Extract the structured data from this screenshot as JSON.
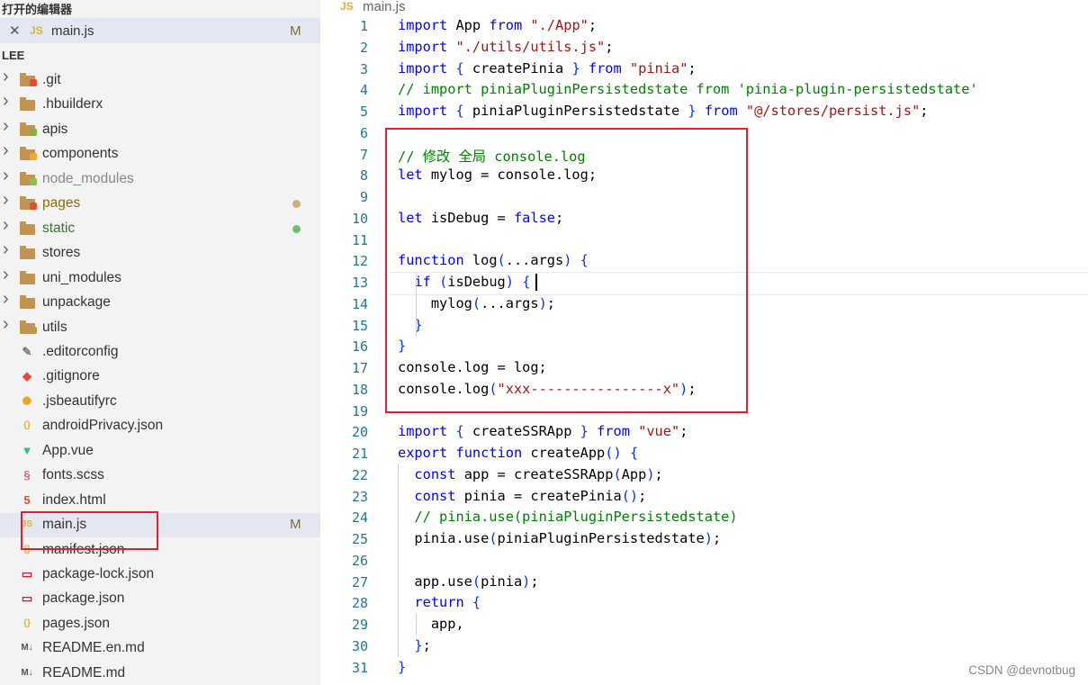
{
  "sidebar": {
    "open_editors_title": "打开的编辑器",
    "open_file": {
      "close": "✕",
      "type": "JS",
      "name": "main.js",
      "status": "M"
    },
    "project_title": "LEE",
    "items": [
      {
        "label": "git",
        "prefix": ".",
        "kind": "folder",
        "icon": "git-folder-icon",
        "color": "#e44c34",
        "expandable": true
      },
      {
        "label": ".hbuilderx",
        "kind": "folder",
        "icon": "folder-icon",
        "color": "#c09553",
        "expandable": true
      },
      {
        "label": "apis",
        "kind": "folder",
        "icon": "api-folder-icon",
        "color": "#7cb342",
        "expandable": true
      },
      {
        "label": "components",
        "kind": "folder",
        "icon": "components-folder-icon",
        "color": "#f0a830",
        "expandable": true
      },
      {
        "label": "node_modules",
        "kind": "folder",
        "icon": "node-folder-icon",
        "color": "#8bc34a",
        "expandable": true,
        "dim": true
      },
      {
        "label": "pages",
        "kind": "folder",
        "icon": "pages-folder-icon",
        "color": "#e44c34",
        "expandable": true,
        "status": "dot-gold"
      },
      {
        "label": "static",
        "kind": "folder",
        "icon": "folder-icon",
        "color": "#c09553",
        "expandable": true,
        "status": "dot-green"
      },
      {
        "label": "stores",
        "kind": "folder",
        "icon": "folder-icon",
        "color": "#c09553",
        "expandable": true
      },
      {
        "label": "uni_modules",
        "kind": "folder",
        "icon": "folder-icon",
        "color": "#c09553",
        "expandable": true
      },
      {
        "label": "unpackage",
        "kind": "folder",
        "icon": "folder-icon",
        "color": "#c09553",
        "expandable": true
      },
      {
        "label": "utils",
        "kind": "folder",
        "icon": "utils-folder-icon",
        "color": "#c09553",
        "expandable": true
      },
      {
        "label": ".editorconfig",
        "kind": "file",
        "icon": "editorconfig-icon"
      },
      {
        "label": ".gitignore",
        "kind": "file",
        "icon": "git-icon"
      },
      {
        "label": ".jsbeautifyrc",
        "kind": "file",
        "icon": "gear-icon"
      },
      {
        "label": "androidPrivacy.json",
        "kind": "file",
        "icon": "json-icon"
      },
      {
        "label": "App.vue",
        "kind": "file",
        "icon": "vue-icon"
      },
      {
        "label": "fonts.scss",
        "kind": "file",
        "icon": "sass-icon"
      },
      {
        "label": "index.html",
        "kind": "file",
        "icon": "html-icon"
      },
      {
        "label": "main.js",
        "kind": "file",
        "icon": "js-icon",
        "selected": true,
        "status": "M"
      },
      {
        "label": "manifest.json",
        "kind": "file",
        "icon": "json-icon"
      },
      {
        "label": "package-lock.json",
        "kind": "file",
        "icon": "npm-icon"
      },
      {
        "label": "package.json",
        "kind": "file",
        "icon": "npm-icon"
      },
      {
        "label": "pages.json",
        "kind": "file",
        "icon": "json-icon"
      },
      {
        "label": "README.en.md",
        "kind": "file",
        "icon": "markdown-icon"
      },
      {
        "label": "README.md",
        "kind": "file",
        "icon": "markdown-icon"
      }
    ]
  },
  "tab": {
    "type": "JS",
    "name": "main.js"
  },
  "code_lines": [
    "import App from \"./App\";",
    "import \"./utils/utils.js\";",
    "import { createPinia } from \"pinia\";",
    "// import piniaPluginPersistedstate from 'pinia-plugin-persistedstate'",
    "import { piniaPluginPersistedstate } from \"@/stores/persist.js\";",
    "",
    "// 修改 全局 console.log",
    "let mylog = console.log;",
    "",
    "let isDebug = false;",
    "",
    "function log(...args) {",
    "  if (isDebug) {",
    "    mylog(...args);",
    "  }",
    "}",
    "console.log = log;",
    "console.log(\"xxx----------------x\");",
    "",
    "import { createSSRApp } from \"vue\";",
    "export function createApp() {",
    "  const app = createSSRApp(App);",
    "  const pinia = createPinia();",
    "  // pinia.use(piniaPluginPersistedstate)",
    "  pinia.use(piniaPluginPersistedstate);",
    "",
    "  app.use(pinia);",
    "  return {",
    "    app,",
    "  };",
    "}"
  ],
  "current_line": 13,
  "watermark": "CSDN @devnotbug"
}
